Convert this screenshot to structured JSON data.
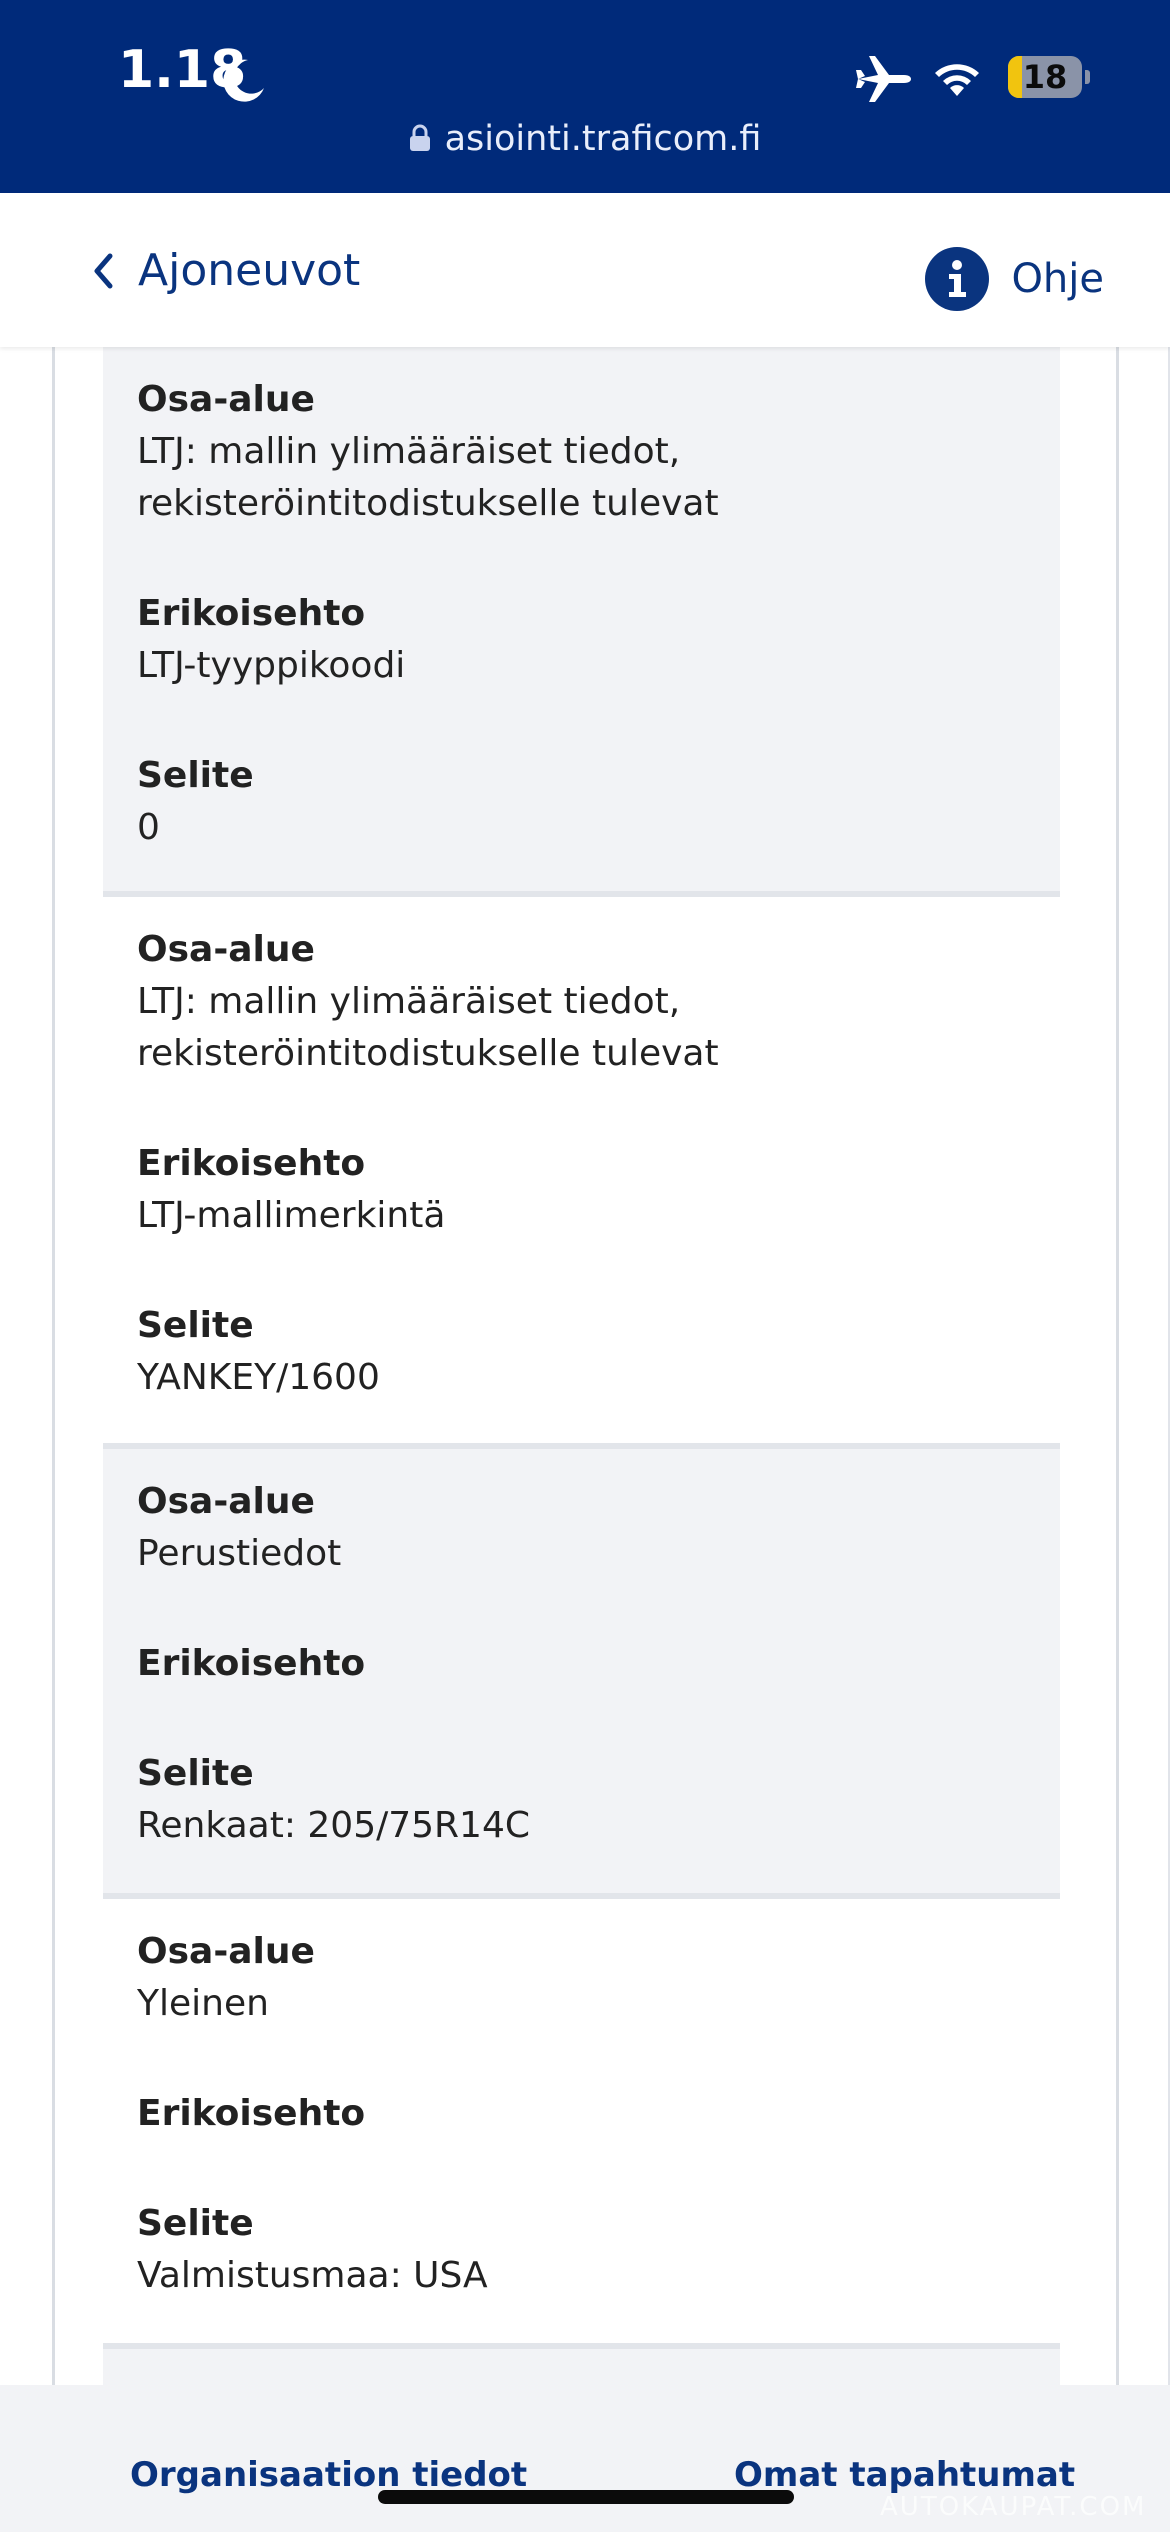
{
  "status_bar": {
    "time": "1.18",
    "battery_level": "18",
    "url": "asiointi.traficom.fi",
    "icons": [
      "moon-icon",
      "airplane-icon",
      "wifi-icon",
      "battery-icon",
      "lock-icon"
    ],
    "background": "#002a7a"
  },
  "header": {
    "back_label": "Ajoneuvot",
    "help_label": "Ohje",
    "accent": "#0a347f"
  },
  "field_labels": {
    "area": "Osa-alue",
    "condition": "Erikoisehto",
    "description": "Selite"
  },
  "records": [
    {
      "area_line1": "LTJ: mallin ylimääräiset tiedot,",
      "area_line2": "rekisteröintitodistukselle tulevat",
      "condition": "LTJ-tyyppikoodi",
      "description": "0"
    },
    {
      "area_line1": "LTJ: mallin ylimääräiset tiedot,",
      "area_line2": "rekisteröintitodistukselle tulevat",
      "condition": "LTJ-mallimerkintä",
      "description": "YANKEY/1600"
    },
    {
      "area_line1": "Perustiedot",
      "area_line2": "",
      "condition": "",
      "description": "Renkaat: 205/75R14C"
    },
    {
      "area_line1": "Yleinen",
      "area_line2": "",
      "condition": "",
      "description": "Valmistusmaa: USA"
    }
  ],
  "bottom_nav": {
    "left_label": "Organisaation tiedot",
    "right_label": "Omat tapahtumat"
  },
  "watermark": "AUTOKAUPAT.COM"
}
